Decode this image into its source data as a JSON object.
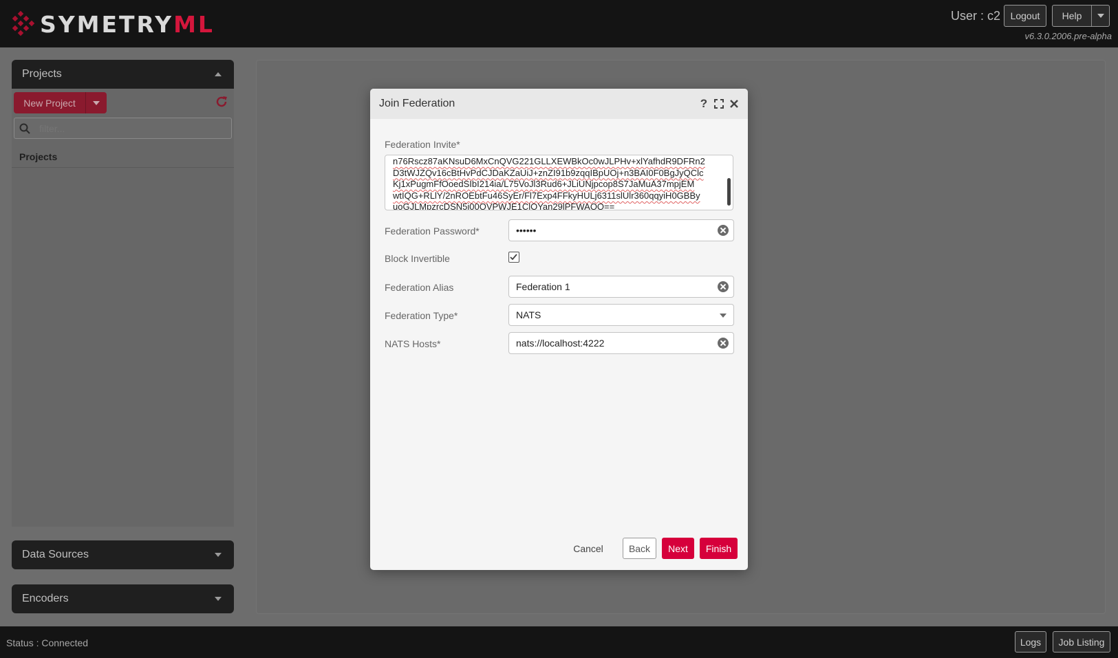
{
  "header": {
    "logo_main": "SYMETRY",
    "logo_accent": "ML",
    "user_label": "User : c2",
    "logout_label": "Logout",
    "help_label": "Help",
    "version": "v6.3.0.2006.pre-alpha"
  },
  "sidebar": {
    "projects_title": "Projects",
    "new_project_label": "New Project",
    "filter_placeholder": "filter...",
    "projects_list_header": "Projects",
    "data_sources_title": "Data Sources",
    "encoders_title": "Encoders"
  },
  "footer": {
    "status": "Status : Connected",
    "logs_label": "Logs",
    "job_listing_label": "Job Listing"
  },
  "modal": {
    "title": "Join Federation",
    "invite_label": "Federation Invite*",
    "invite_lines": [
      "n76Rscz87aKNsuD6MxCnQVG221GLLXEWBkOc0wJLPHv+xlYafhdR9DFRn2",
      "D3tWJZQv16cBtHvPdCJDaKZaUiJ+znZI91b9zqqIBpUOj+n3BAI0F0BgJyQClc",
      "Kj1xPugmFfOoedSIbI214ia/L75VoJl3Rud6+JLiUNjpcop8S7JaMuA37mpjEM",
      "wtIQG+RLlY/2nROEbtFu46SyEr/Fl7Exp4FFkyHULj6311slUlr360qqyiH0GBBy",
      "uoGJLMpzrcDSN5i00QVPWJE1ClOYan29lPFWAQQ=="
    ],
    "password_label": "Federation Password*",
    "password_value": "••••••",
    "block_invertible_label": "Block Invertible",
    "alias_label": "Federation Alias",
    "alias_value": "Federation 1",
    "type_label": "Federation Type*",
    "type_value": "NATS",
    "hosts_label": "NATS Hosts*",
    "hosts_value": "nats://localhost:4222",
    "cancel_label": "Cancel",
    "back_label": "Back",
    "next_label": "Next",
    "finish_label": "Finish"
  },
  "colors": {
    "accent": "#d6003b",
    "header_bg": "#141414"
  }
}
